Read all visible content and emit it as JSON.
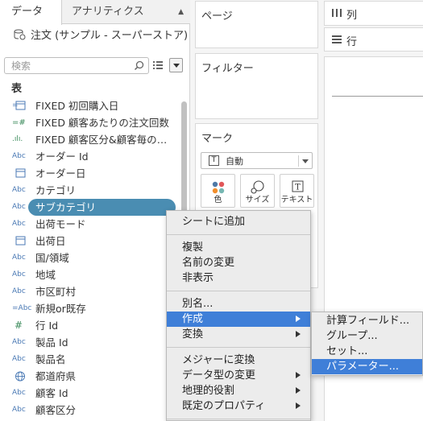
{
  "tabs": [
    {
      "label": "データ",
      "active": true
    },
    {
      "label": "アナリティクス",
      "active": false
    }
  ],
  "data_source": {
    "label": "注文 (サンプル - スーパーストア)",
    "icon": "datasource-icon"
  },
  "search": {
    "placeholder": "検索",
    "value": ""
  },
  "section_header": "表",
  "fields": [
    {
      "icon": "calculated-date-icon",
      "icon_text": "=",
      "label": "FIXED 初回購入日"
    },
    {
      "icon": "calculated-number-icon",
      "icon_text": "=#",
      "label": "FIXED 顧客あたりの注文回数"
    },
    {
      "icon": "calculated-bin-icon",
      "icon_text": ".ılı.",
      "label": "FIXED 顧客区分&顧客毎の売..."
    },
    {
      "icon": "string-icon",
      "icon_text": "Abc",
      "label": "オーダー Id"
    },
    {
      "icon": "date-icon",
      "icon_text": "",
      "label": "オーダー日"
    },
    {
      "icon": "string-icon",
      "icon_text": "Abc",
      "label": "カテゴリ"
    },
    {
      "icon": "string-icon",
      "icon_text": "Abc",
      "label": "サブカテゴリ",
      "selected": true
    },
    {
      "icon": "string-icon",
      "icon_text": "Abc",
      "label": "出荷モード"
    },
    {
      "icon": "date-icon",
      "icon_text": "",
      "label": "出荷日"
    },
    {
      "icon": "string-icon",
      "icon_text": "Abc",
      "label": "国/領域"
    },
    {
      "icon": "string-icon",
      "icon_text": "Abc",
      "label": "地域"
    },
    {
      "icon": "string-icon",
      "icon_text": "Abc",
      "label": "市区町村"
    },
    {
      "icon": "calculated-string-icon",
      "icon_text": "=Abc",
      "label": "新規or既存"
    },
    {
      "icon": "number-icon",
      "icon_text": "#",
      "label": "行 Id"
    },
    {
      "icon": "string-icon",
      "icon_text": "Abc",
      "label": "製品 Id"
    },
    {
      "icon": "string-icon",
      "icon_text": "Abc",
      "label": "製品名"
    },
    {
      "icon": "geo-icon",
      "icon_text": "",
      "label": "都道府県"
    },
    {
      "icon": "string-icon",
      "icon_text": "Abc",
      "label": "顧客 Id"
    },
    {
      "icon": "string-icon",
      "icon_text": "Abc",
      "label": "顧客区分"
    }
  ],
  "shelves": {
    "pages": "ページ",
    "filters": "フィルター",
    "marks": "マーク",
    "columns": "列",
    "rows": "行"
  },
  "marks_card": {
    "mark_type": "自動",
    "buttons": [
      {
        "label": "色",
        "icon": "color-icon"
      },
      {
        "label": "サイズ",
        "icon": "size-icon"
      },
      {
        "label": "テキスト",
        "icon": "text-icon"
      }
    ]
  },
  "context_menu": {
    "items": [
      {
        "label": "シートに追加"
      },
      {
        "separator": true
      },
      {
        "label": "複製"
      },
      {
        "label": "名前の変更"
      },
      {
        "label": "非表示"
      },
      {
        "separator": true
      },
      {
        "label": "別名..."
      },
      {
        "label": "作成",
        "submenu": true,
        "highlight": true
      },
      {
        "label": "変換",
        "submenu": true
      },
      {
        "separator": true
      },
      {
        "label": "メジャーに変換"
      },
      {
        "label": "データ型の変更",
        "submenu": true
      },
      {
        "label": "地理的役割",
        "submenu": true
      },
      {
        "label": "既定のプロパティ",
        "submenu": true
      },
      {
        "separator": true
      }
    ]
  },
  "submenu": {
    "items": [
      {
        "label": "計算フィールド..."
      },
      {
        "label": "グループ..."
      },
      {
        "label": "セット..."
      },
      {
        "label": "パラメーター...",
        "highlight": true
      }
    ]
  },
  "colors": {
    "selected_field": "#4a8db2",
    "menu_highlight": "#3f7fd8",
    "field_icon": "#4b7ab5"
  }
}
